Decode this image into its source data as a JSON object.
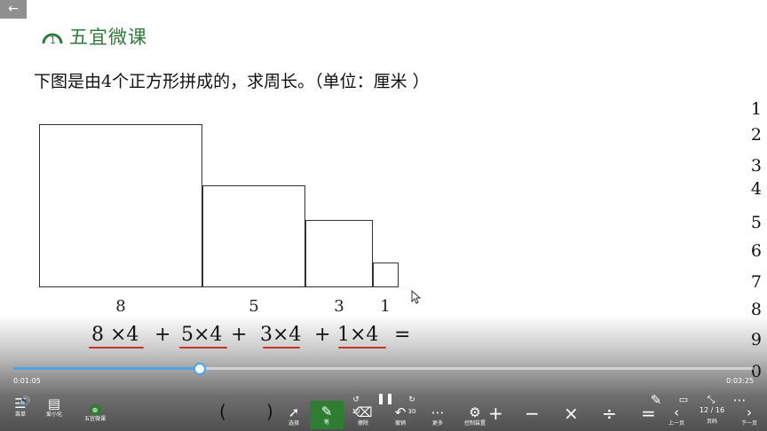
{
  "header": {
    "back_icon": "arrow-left-icon",
    "brand": "五宜微课"
  },
  "question": "下图是由4个正方形拼成的，求周长。（单位：厘米 ）",
  "right_column": [
    "1",
    "2",
    "3",
    "4",
    "5",
    "6",
    "7",
    "8",
    "9",
    "0"
  ],
  "squares": {
    "labels": [
      "8",
      "5",
      "3",
      "1"
    ]
  },
  "formula": {
    "t1": "8 ×4",
    "p1": "+",
    "t2": "5×4",
    "p2": "+",
    "t3": "3×4",
    "p3": "+",
    "t4": "1×4",
    "eq": "="
  },
  "player": {
    "progress": 0.25,
    "current_time": "0:01:05",
    "total_time": "0:03:25"
  },
  "toolbar": {
    "left": [
      {
        "icon": "menu-icon",
        "label": "菜单"
      },
      {
        "icon": "visual-icon",
        "label": "爱小化"
      },
      {
        "icon": "wuyi-logo-icon",
        "label": "五宜微课"
      }
    ],
    "paren_open": "(",
    "paren_close": ")",
    "center": [
      {
        "icon": "cursor-icon",
        "label": "选择"
      },
      {
        "icon": "pen-icon",
        "label": "笔"
      },
      {
        "icon": "eraser-icon",
        "label": "擦除"
      },
      {
        "icon": "undo-icon",
        "label": "撤销"
      },
      {
        "icon": "more-icon",
        "label": "更多"
      },
      {
        "icon": "control-icon",
        "label": "控制装置"
      }
    ],
    "skip_back": "10",
    "skip_forward": "30",
    "operators": [
      "+",
      "−",
      "×",
      "÷",
      "="
    ],
    "prev_label": "上一页",
    "page": "12 / 16",
    "next_label": "下一页",
    "page_label": "页码"
  }
}
